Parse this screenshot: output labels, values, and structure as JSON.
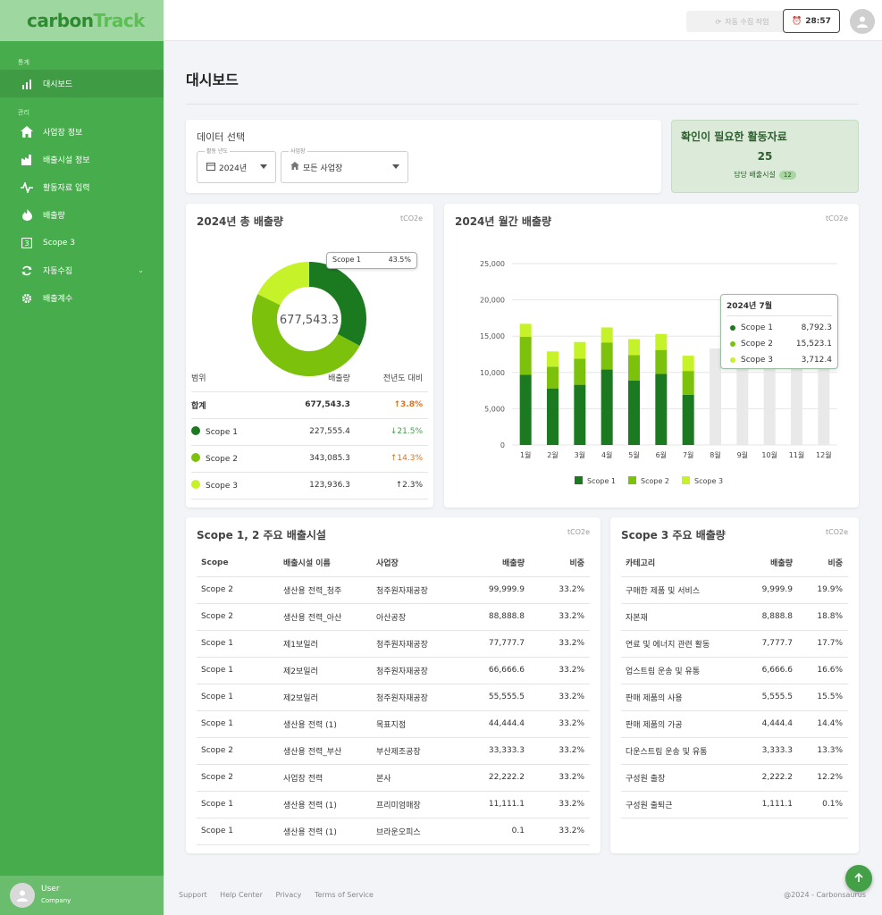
{
  "app": {
    "brand_a": "carbon",
    "brand_b": "Track"
  },
  "sidebar": {
    "section1": "통계",
    "section2": "관리",
    "items": [
      {
        "label": "대시보드",
        "icon": "bar-chart-icon"
      },
      {
        "label": "사업장 정보",
        "icon": "home-icon"
      },
      {
        "label": "배출시설 정보",
        "icon": "factory-icon"
      },
      {
        "label": "활동자료 입력",
        "icon": "activity-icon"
      },
      {
        "label": "배출량",
        "icon": "flame-icon"
      },
      {
        "label": "Scope 3",
        "icon": "scope3-icon"
      },
      {
        "label": "자동수집",
        "icon": "sync-icon"
      },
      {
        "label": "배출계수",
        "icon": "gear-icon"
      }
    ],
    "user": {
      "name": "User",
      "company": "Company"
    }
  },
  "topbar": {
    "auto_label": "자동 수집 작업",
    "timer": "28:57"
  },
  "page": {
    "title": "대시보드"
  },
  "data_select": {
    "title": "데이터 선택",
    "year_label": "활동 년도",
    "year_value": "2024년",
    "site_label": "사업장",
    "site_value": "모든 사업장"
  },
  "alert": {
    "title": "확인이 필요한 활동자료",
    "count": "25",
    "sub": "담당 배출시설",
    "badge": "12"
  },
  "total": {
    "title": "2024년 총 배출량",
    "unit": "tCO2e",
    "center": "677,543.3",
    "tooltip_label": "Scope 1",
    "tooltip_value": "43.5%",
    "headers": [
      "범위",
      "배출량",
      "전년도 대비"
    ],
    "rows": [
      {
        "name": "합계",
        "value": "677,543.3",
        "change": "↑3.8%",
        "dir": "up",
        "color": ""
      },
      {
        "name": "Scope 1",
        "value": "227,555.4",
        "change": "↓21.5%",
        "dir": "down",
        "color": "#1b7a1f"
      },
      {
        "name": "Scope 2",
        "value": "343,085.3",
        "change": "↑14.3%",
        "dir": "up",
        "color": "#7cc10b"
      },
      {
        "name": "Scope 3",
        "value": "123,936.3",
        "change": "↑2.3%",
        "dir": "upg",
        "color": "#c6f22a"
      }
    ]
  },
  "monthly": {
    "title": "2024년 월간 배출량",
    "unit": "tCO2e",
    "tooltip": {
      "title": "2024년 7월",
      "items": [
        {
          "label": "Scope 1",
          "value": "8,792.3"
        },
        {
          "label": "Scope 2",
          "value": "15,523.1"
        },
        {
          "label": "Scope 3",
          "value": "3,712.4"
        }
      ]
    }
  },
  "chart_data": [
    {
      "type": "pie",
      "title": "2024년 총 배출량",
      "labels": [
        "Scope 1",
        "Scope 2",
        "Scope 3"
      ],
      "values": [
        227555.4,
        343085.3,
        123936.3
      ],
      "colors": [
        "#1b7a1f",
        "#7cc10b",
        "#c6f22a"
      ]
    },
    {
      "type": "bar",
      "stacked": true,
      "title": "2024년 월간 배출량",
      "categories": [
        "1월",
        "2월",
        "3월",
        "4월",
        "5월",
        "6월",
        "7월",
        "8월",
        "9월",
        "10월",
        "11월",
        "12월"
      ],
      "series": [
        {
          "name": "Scope 1",
          "color": "#1b7a1f",
          "values": [
            9700,
            7800,
            8300,
            10400,
            8900,
            9800,
            6900,
            null,
            null,
            null,
            null,
            null
          ]
        },
        {
          "name": "Scope 2",
          "color": "#7cc10b",
          "values": [
            5200,
            3000,
            3600,
            3700,
            3500,
            3300,
            3300,
            null,
            null,
            null,
            null,
            null
          ]
        },
        {
          "name": "Scope 3",
          "color": "#c6f22a",
          "values": [
            1800,
            2100,
            2300,
            2100,
            2200,
            2200,
            2100,
            null,
            null,
            null,
            null,
            null
          ]
        }
      ],
      "placeholder": {
        "color": "#e9e9e9",
        "values": [
          null,
          null,
          null,
          null,
          null,
          null,
          null,
          13300,
          13300,
          13300,
          13300,
          13300
        ]
      },
      "yticks": [
        "0",
        "5,000",
        "10,000",
        "15,000",
        "20,000",
        "25,000"
      ],
      "ylim": [
        0,
        25000
      ],
      "grid": true,
      "legend": "bottom"
    }
  ],
  "scope12": {
    "title": "Scope 1, 2 주요 배출시설",
    "unit": "tCO2e",
    "headers": [
      "Scope",
      "배출시설 이름",
      "사업장",
      "배출량",
      "비중"
    ],
    "rows": [
      [
        "Scope 2",
        "생산용 전력_청주",
        "청주원자재공장",
        "99,999.9",
        "33.2%"
      ],
      [
        "Scope 2",
        "생산용 전력_아산",
        "아산공장",
        "88,888.8",
        "33.2%"
      ],
      [
        "Scope 1",
        "제1보일러",
        "청주원자재공장",
        "77,777.7",
        "33.2%"
      ],
      [
        "Scope 1",
        "제2보일러",
        "청주원자재공장",
        "66,666.6",
        "33.2%"
      ],
      [
        "Scope 1",
        "제2보일러",
        "청주원자재공장",
        "55,555.5",
        "33.2%"
      ],
      [
        "Scope 1",
        "생산용 전력 (1)",
        "목표지점",
        "44,444.4",
        "33.2%"
      ],
      [
        "Scope 2",
        "생산용 전력_부산",
        "부산제조공장",
        "33,333.3",
        "33.2%"
      ],
      [
        "Scope 2",
        "사업장 전력",
        "본사",
        "22,222.2",
        "33.2%"
      ],
      [
        "Scope 1",
        "생산용 전력 (1)",
        "프리미엄매장",
        "11,111.1",
        "33.2%"
      ],
      [
        "Scope 1",
        "생산용 전력 (1)",
        "브라운오피스",
        "0.1",
        "33.2%"
      ]
    ]
  },
  "scope3": {
    "title": "Scope 3  주요 배출량",
    "unit": "tCO2e",
    "headers": [
      "카테고리",
      "배출량",
      "비중"
    ],
    "rows": [
      [
        "구매한 제품 및 서비스",
        "9,999.9",
        "19.9%"
      ],
      [
        "자본재",
        "8,888.8",
        "18.8%"
      ],
      [
        "연료 및 에너지 관련 활동",
        "7,777.7",
        "17.7%"
      ],
      [
        "업스트림 운송 및 유통",
        "6,666.6",
        "16.6%"
      ],
      [
        "판매 제품의 사용",
        "5,555.5",
        "15.5%"
      ],
      [
        "판매 제품의 가공",
        "4,444.4",
        "14.4%"
      ],
      [
        "다운스트림 운송 및 유통",
        "3,333.3",
        "13.3%"
      ],
      [
        "구성원 출장",
        "2,222.2",
        "12.2%"
      ],
      [
        "구성원 출퇴근",
        "1,111.1",
        "0.1%"
      ]
    ]
  },
  "footer": {
    "links": [
      "Support",
      "Help Center",
      "Privacy",
      "Terms of Service"
    ],
    "copyright": "@2024 - Carbonsaurus"
  }
}
